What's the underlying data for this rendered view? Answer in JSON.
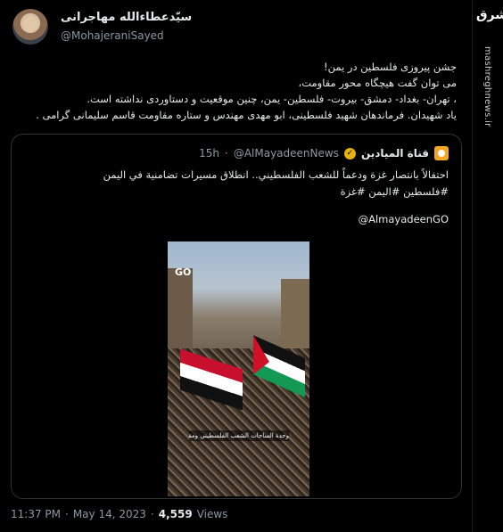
{
  "author": {
    "name": "سیّدعطاءالله مهاجرانی",
    "handle": "@MohajeraniSayed"
  },
  "tweet": {
    "lines": [
      "جشن پیروزی فلسطین در یمن!",
      "می توان گفت هیچگاه محور مقاومت،",
      "، تهران- بغداد- دمشق- بیروت- فلسطین- یمن، چنین  موقعیت و دستاوردی نداشته است.",
      "یاد شهیدان. فرماندهان شهید فلسطینی، ابو مهدی مهندس و ستاره مقاومت قاسم سلیمانی گرامی ."
    ]
  },
  "quote": {
    "name": "قناة الميادين",
    "handle": "@AlMayadeenNews",
    "time": "15h",
    "text_lines": [
      "احتفالاً بانتصار غزة ودعماً للشعب الفلسطيني.. انطلاق مسيرات تضامنية في اليمن",
      "#فلسطين #اليمن #غزة"
    ],
    "mention": "@AlmayadeenGO",
    "video_logo": "GO",
    "video_caption": "وحدة الساحات الشعب الفلسطيني ومقاومته"
  },
  "footer": {
    "time": "11:37 PM",
    "date": "May 14, 2023",
    "views_count": "4,559",
    "views_label": "Views"
  },
  "watermark": {
    "logo": "مشرق",
    "url": "mashreghnews.ir"
  }
}
